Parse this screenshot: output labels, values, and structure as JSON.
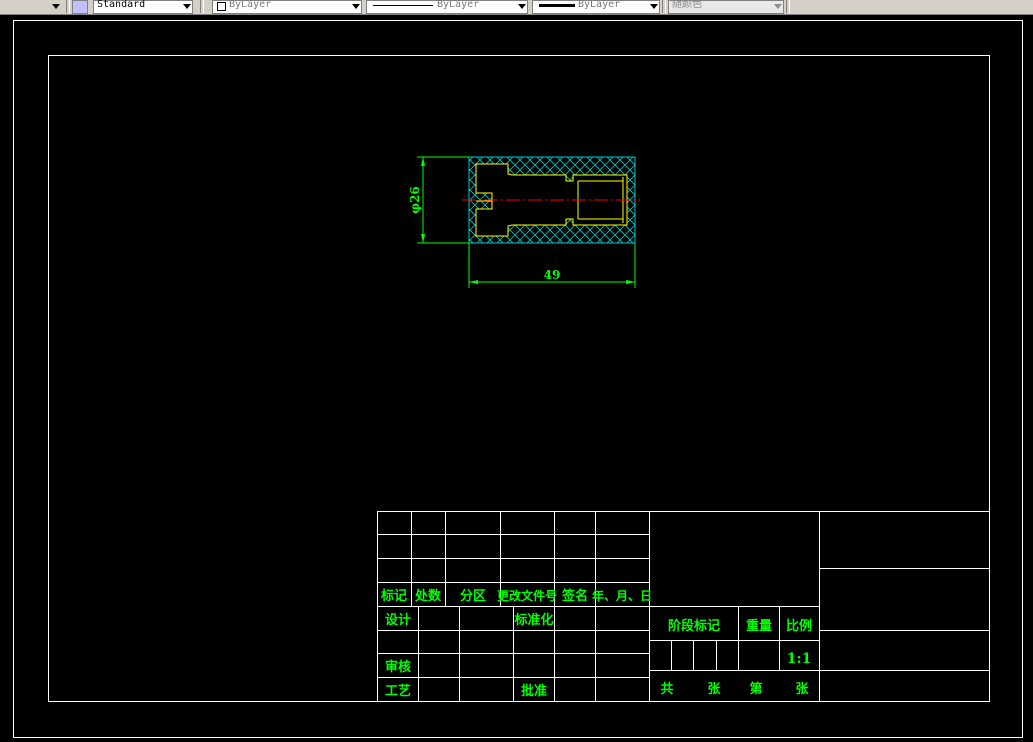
{
  "toolbar": {
    "text_style": "Standard",
    "layer": "ByLayer",
    "linetype": "ByLayer",
    "lineweight": "ByLayer",
    "plot_color": "随颜色"
  },
  "drawing": {
    "dimension_diameter": "φ26",
    "dimension_length": "49",
    "colors": {
      "background": "#000000",
      "frame": "#ffffff",
      "dimension": "#00ff00",
      "hatch": "#00c8c8",
      "part_edge": "#ffff00",
      "centerline": "#ff0000"
    }
  },
  "title_block": {
    "rev_headers": [
      "标记",
      "处数",
      "分区",
      "更改文件号",
      "签名",
      "年、月、日"
    ],
    "design": "设计",
    "standardization": "标准化",
    "review": "审核",
    "process": "工艺",
    "approve": "批准",
    "stage_mark": "阶段标记",
    "weight": "重量",
    "scale_label": "比例",
    "scale_value": "1:1",
    "total": "共",
    "sheets1": "张",
    "page": "第",
    "sheets2": "张"
  }
}
